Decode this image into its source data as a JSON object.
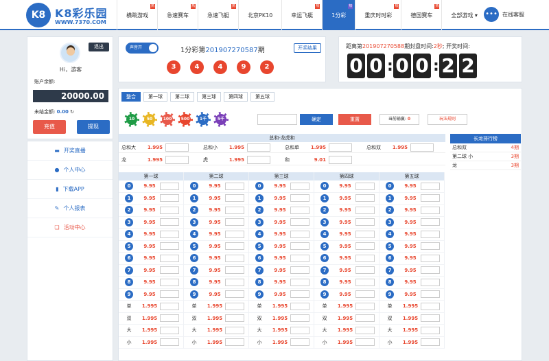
{
  "brand": {
    "title": "K8彩乐园",
    "url": "WWW.7370.COM",
    "badge": "K8"
  },
  "nav": [
    {
      "label": "横跳游戏",
      "badge": "热"
    },
    {
      "label": "急速赛车",
      "badge": "热"
    },
    {
      "label": "急速飞艇",
      "badge": "热"
    },
    {
      "label": "北京PK10",
      "badge": ""
    },
    {
      "label": "幸运飞艇",
      "badge": "热"
    },
    {
      "label": "1分彩",
      "badge": "热"
    },
    {
      "label": "重庆时时彩",
      "badge": "热"
    },
    {
      "label": "德国赛车",
      "badge": "热"
    },
    {
      "label": "全部游戏 ▾",
      "badge": ""
    }
  ],
  "support": "在线客服",
  "user": {
    "logout": "退出",
    "greet": "Hi，游客",
    "balance_label": "账户余额:",
    "balance": "20000.00",
    "pending_label": "未结金额:",
    "pending": "0.00",
    "deposit": "充值",
    "withdraw": "提现"
  },
  "menu": [
    "开奖直播",
    "个人中心",
    "下载APP",
    "个人报表",
    "活动中心"
  ],
  "game": {
    "sound": "声音开",
    "issue_prefix": "1分彩第",
    "issue": "201907270587",
    "issue_suffix": "期",
    "result_btn": "开奖结果",
    "balls": [
      "3",
      "4",
      "4",
      "9",
      "2"
    ]
  },
  "timer": {
    "prefix": "距离第",
    "issue": "201907270588",
    "mid": "期封盘时间:",
    "close": "2秒",
    "tail": "; 开奖时间:",
    "digits": [
      "0",
      "0",
      "0",
      "0",
      "2",
      "2"
    ]
  },
  "tabs": [
    "整合",
    "第一球",
    "第二球",
    "第三球",
    "第四球",
    "第五球"
  ],
  "chips": [
    "10",
    "50",
    "100",
    "500",
    "1千",
    "5千"
  ],
  "actions": {
    "confirm": "确定",
    "reset": "重置",
    "note_label": "当前输赢:",
    "note_value": "0",
    "rules": "玩法规则"
  },
  "totals": {
    "head": "总和-龙虎和",
    "rows": [
      [
        {
          "l": "总和大",
          "o": "1.995"
        },
        {
          "l": "总和小",
          "o": "1.995"
        },
        {
          "l": "总和单",
          "o": "1.995"
        },
        {
          "l": "总和双",
          "o": "1.995"
        }
      ],
      [
        {
          "l": "龙",
          "o": "1.995"
        },
        {
          "l": "虎",
          "o": "1.995"
        },
        {
          "l": "和",
          "o": "9.01"
        },
        {
          "l": "",
          "o": ""
        }
      ]
    ]
  },
  "columns": [
    "第一球",
    "第二球",
    "第三球",
    "第四球",
    "第五球"
  ],
  "digits_odds": "9.95",
  "bs_labels": [
    "单",
    "双",
    "大",
    "小"
  ],
  "bs_odds": "1.995",
  "rank": {
    "title": "长龙排行榜",
    "rows": [
      {
        "k": "总和双",
        "v": "4期"
      },
      {
        "k": "第二球 小",
        "v": "3期"
      },
      {
        "k": "龙",
        "v": "3期"
      }
    ]
  }
}
